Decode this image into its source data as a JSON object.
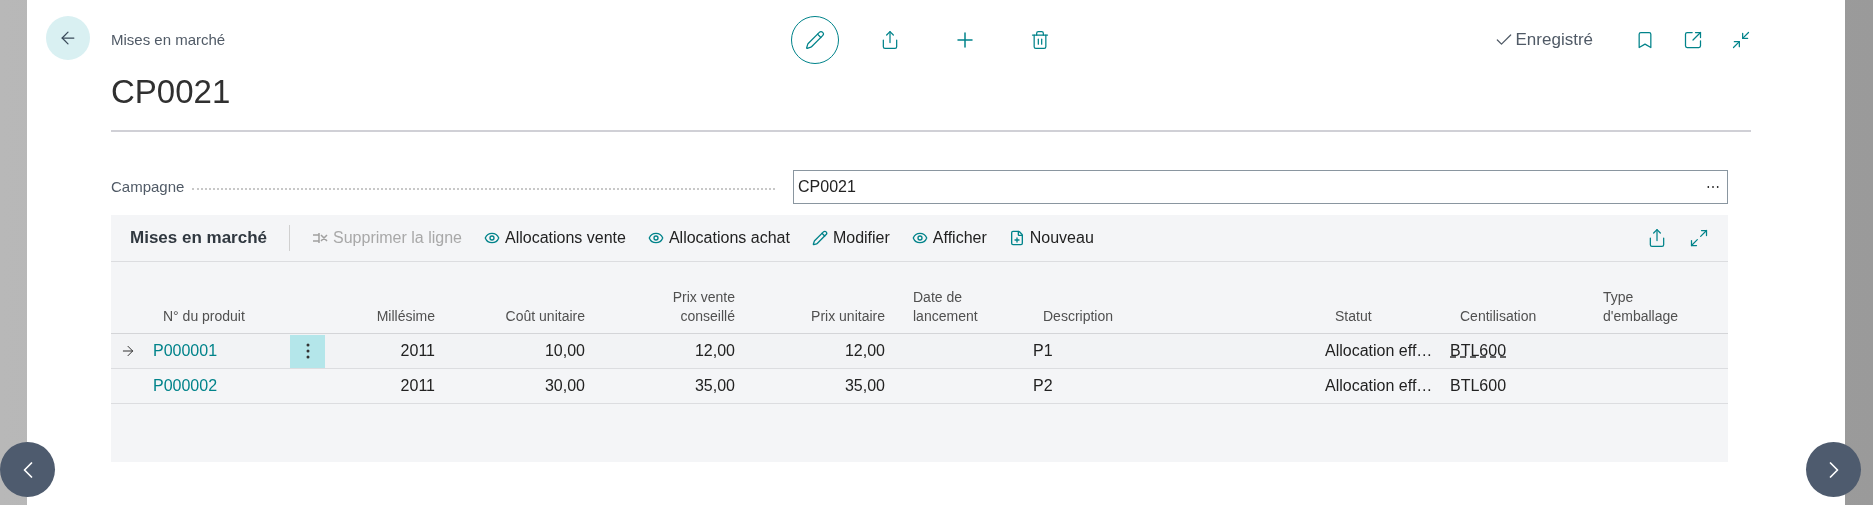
{
  "page": {
    "caption": "Mises en marché",
    "title": "CP0021",
    "status": "Enregistré"
  },
  "field": {
    "label": "Campagne",
    "value": "CP0021",
    "more": "⋯"
  },
  "part": {
    "title": "Mises en marché",
    "actions": [
      {
        "kind": "delete",
        "label": "Supprimer la ligne",
        "disabled": true
      },
      {
        "kind": "view",
        "label": "Allocations vente",
        "disabled": false
      },
      {
        "kind": "view",
        "label": "Allocations achat",
        "disabled": false
      },
      {
        "kind": "edit",
        "label": "Modifier",
        "disabled": false
      },
      {
        "kind": "view",
        "label": "Afficher",
        "disabled": false
      },
      {
        "kind": "new",
        "label": "Nouveau",
        "disabled": false
      }
    ]
  },
  "table": {
    "columns": [
      {
        "label": "N° du produit"
      },
      {
        "label": "Millésime"
      },
      {
        "label": "Coût unitaire"
      },
      {
        "label": "Prix vente conseillé"
      },
      {
        "label": "Prix unitaire"
      },
      {
        "label": "Date de lancement"
      },
      {
        "label": "Description"
      },
      {
        "label": "Statut"
      },
      {
        "label": "Centilisation"
      },
      {
        "label": "Type d'emballage"
      }
    ],
    "rows": [
      {
        "selected": true,
        "cells": [
          "P000001",
          "2011",
          "10,00",
          "12,00",
          "12,00",
          "",
          "P1",
          "Allocation eff…",
          "BTL600",
          ""
        ]
      },
      {
        "selected": false,
        "cells": [
          "P000002",
          "2011",
          "30,00",
          "35,00",
          "35,00",
          "",
          "P2",
          "Allocation eff…",
          "BTL600",
          ""
        ]
      }
    ]
  }
}
